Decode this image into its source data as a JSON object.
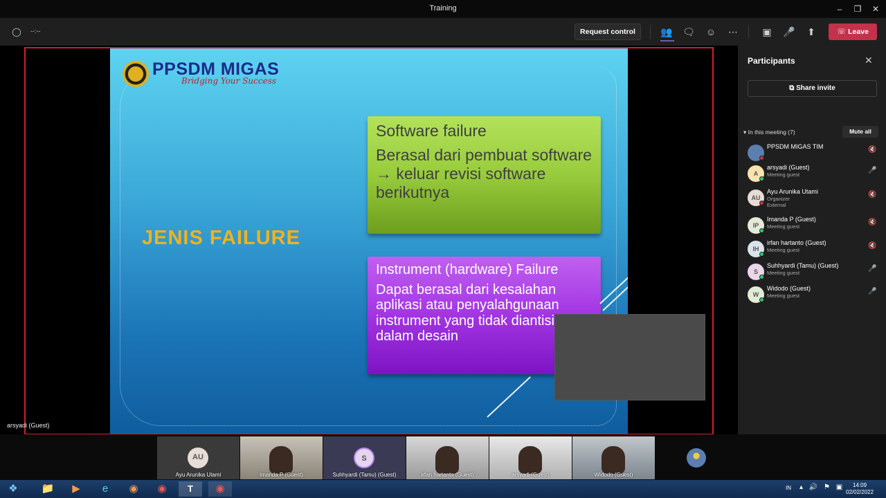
{
  "window": {
    "title": "Training"
  },
  "toolbar": {
    "timer": "--:--",
    "request_control": "Request control",
    "leave": "Leave"
  },
  "slide": {
    "logo_title": "PPSDM MIGAS",
    "logo_tagline": "Bridging Your Success",
    "heading": "JENIS FAILURE",
    "box1_title": "Software  failure",
    "box1_body": "Berasal dari pembuat software → keluar revisi software berikutnya",
    "box2_title": "Instrument (hardware)  Failure",
    "box2_body": "Dapat berasal dari kesalahan aplikasi atau penyalahgunaan instrument yang tidak diantisipasi dalam desain"
  },
  "stage": {
    "presenter_label": "arsyadi (Guest)"
  },
  "panel": {
    "title": "Participants",
    "share_invite": "Share invite",
    "in_meeting": "In this meeting (7)",
    "mute_all": "Mute all",
    "participants": [
      {
        "initials": "",
        "name": "PPSDM MIGAS TIM",
        "sub": "",
        "sub2": "",
        "avatar_color": "#5a7fb0",
        "status_color": "#c4314b",
        "mic": "muted"
      },
      {
        "initials": "A",
        "name": "arsyadi (Guest)",
        "sub": "Meeting guest",
        "sub2": "",
        "avatar_color": "#f6e3b0",
        "status_color": "#2ecc71",
        "mic": "on"
      },
      {
        "initials": "AU",
        "name": "Ayu Arunika Utami",
        "sub": "Organizer",
        "sub2": "External",
        "avatar_color": "#e8ddd6",
        "status_color": "#c4314b",
        "mic": "muted"
      },
      {
        "initials": "IP",
        "name": "Imanda P (Guest)",
        "sub": "Meeting guest",
        "sub2": "",
        "avatar_color": "#e3ead6",
        "status_color": "#2ecc71",
        "mic": "muted"
      },
      {
        "initials": "IH",
        "name": "irfan hartanto (Guest)",
        "sub": "Meeting guest",
        "sub2": "",
        "avatar_color": "#dbe3ea",
        "status_color": "#2ecc71",
        "mic": "muted"
      },
      {
        "initials": "S",
        "name": "Suhhyardi (Tamu) (Guest)",
        "sub": "Meeting guest",
        "sub2": "",
        "avatar_color": "#ead6e8",
        "status_color": "#2ecc71",
        "mic": "on"
      },
      {
        "initials": "W",
        "name": "Widodo (Guest)",
        "sub": "Meeting guest",
        "sub2": "",
        "avatar_color": "#e3ead6",
        "status_color": "#2ecc71",
        "mic": "on"
      }
    ]
  },
  "gallery": [
    {
      "label": "Ayu Arunika Utami",
      "initials": "AU"
    },
    {
      "label": "Imanda P (Guest)",
      "initials": ""
    },
    {
      "label": "Suhhyardi (Tamu) (Guest)",
      "initials": "S"
    },
    {
      "label": "irfan hartanto (Guest)",
      "initials": ""
    },
    {
      "label": "arsyadi (Guest)",
      "initials": ""
    },
    {
      "label": "Widodo (Guest)",
      "initials": ""
    }
  ],
  "taskbar": {
    "lang": "IN",
    "time": "14:09",
    "date": "02/02/2022"
  },
  "colors": {
    "leave": "#c4314b",
    "frame": "#d21e2c",
    "accent": "#6264a7"
  }
}
